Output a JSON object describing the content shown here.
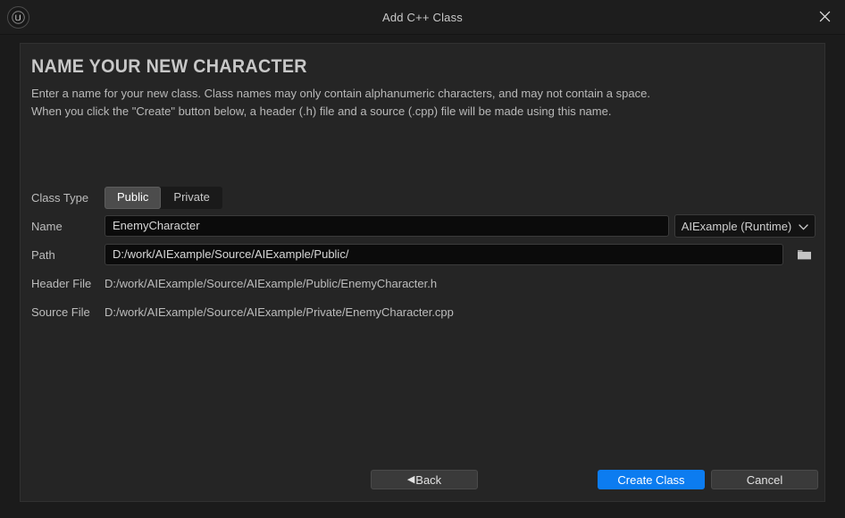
{
  "window": {
    "title": "Add C++ Class",
    "logo_icon": "unreal-engine-logo",
    "close_icon": "close-icon"
  },
  "panel": {
    "heading": "NAME YOUR NEW CHARACTER",
    "description_line1": "Enter a name for your new class. Class names may only contain alphanumeric characters, and may not contain a space.",
    "description_line2": "When you click the \"Create\" button below, a header (.h) file and a source (.cpp) file will be made using this name."
  },
  "form": {
    "class_type": {
      "label": "Class Type",
      "options": [
        "Public",
        "Private"
      ],
      "selected": "Public"
    },
    "name": {
      "label": "Name",
      "value": "EnemyCharacter",
      "placeholder": "Name"
    },
    "module": {
      "value": "AIExample (Runtime)",
      "chevron_icon": "chevron-down-icon"
    },
    "path": {
      "label": "Path",
      "value": "D:/work/AIExample/Source/AIExample/Public/",
      "placeholder": "Path",
      "browse_icon": "folder-icon"
    },
    "header_file": {
      "label": "Header File",
      "value": "D:/work/AIExample/Source/AIExample/Public/EnemyCharacter.h"
    },
    "source_file": {
      "label": "Source File",
      "value": "D:/work/AIExample/Source/AIExample/Private/EnemyCharacter.cpp"
    }
  },
  "footer": {
    "back_label": "Back",
    "back_arrow_glyph": "◀",
    "create_label": "Create Class",
    "cancel_label": "Cancel"
  },
  "colors": {
    "accent": "#0c7cf0",
    "window_bg": "#1b1b1b",
    "panel_bg": "#252525",
    "input_bg": "#0b0b0b",
    "segment_selected": "#4c4c4c"
  }
}
